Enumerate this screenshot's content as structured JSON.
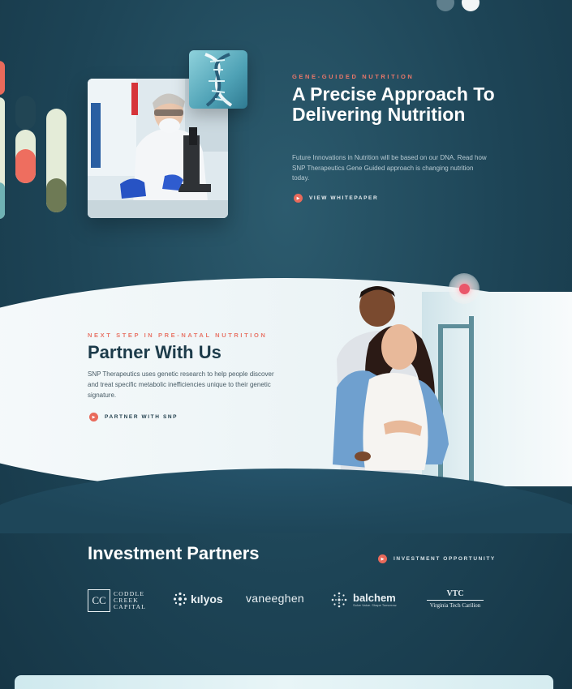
{
  "hero": {
    "eyebrow": "GENE-GUIDED NUTRITION",
    "title": "A Precise Approach To Delivering Nutrition",
    "description": "Future Innovations in Nutrition will be based on our DNA. Read how SNP Therapeutics Gene Guided approach is changing nutrition today.",
    "cta_label": "VIEW WHITEPAPER"
  },
  "partner": {
    "eyebrow": "NEXT STEP IN PRE-NATAL NUTRITION",
    "title": "Partner With Us",
    "description": "SNP Therapeutics uses genetic research to help people discover and treat specific metabolic inefficiencies unique to their genetic signature.",
    "cta_label": "PARTNER WITH SNP"
  },
  "investment": {
    "title": "Investment Partners",
    "cta_label": "INVESTMENT OPPORTUNITY",
    "logos": {
      "coddle_creek": {
        "mark": "CC",
        "line1": "CODDLE",
        "line2": "CREEK",
        "line3": "CAPITAL"
      },
      "kilyos": {
        "name": "kılyos"
      },
      "vaneeghen": {
        "name": "vaneeghen"
      },
      "balchem": {
        "name": "balchem",
        "tagline": "Solve Value. Shape Tomorrow."
      },
      "vtc": {
        "name": "VTC",
        "subtitle": "Virginia Tech Carilion"
      }
    }
  },
  "colors": {
    "accent": "#e96a5b",
    "background": "#1d4456",
    "heading_dark": "#1c3b4a"
  },
  "icons": {
    "cta": "play-arrow-icon",
    "record": "record-icon"
  }
}
